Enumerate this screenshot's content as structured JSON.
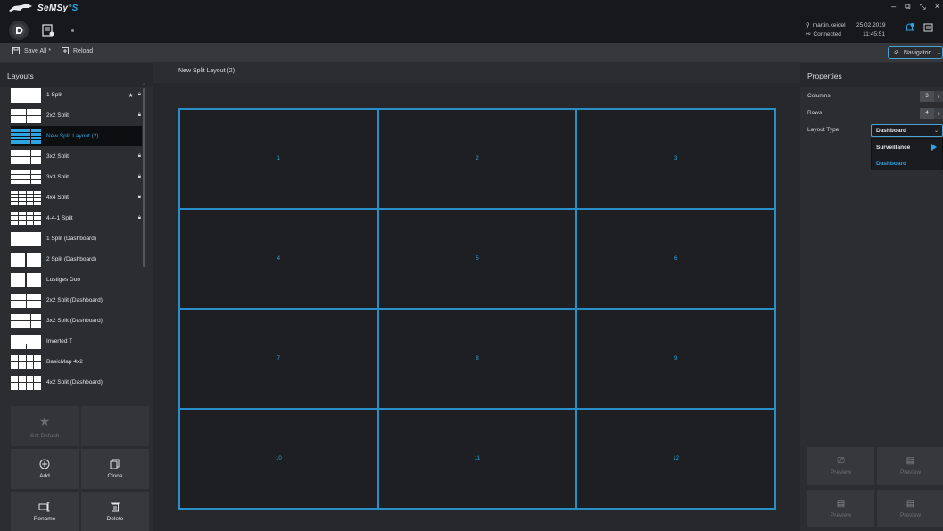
{
  "app": {
    "brand_text": "SeMSy",
    "brand_suffix": "°S"
  },
  "header": {
    "user_name": "martin.keidel",
    "connection_status": "Connected",
    "date": "25.02.2019",
    "time": "11:45:51"
  },
  "toolbar": {
    "save_all_label": "Save All *",
    "reload_label": "Reload",
    "navigator_label": "Navigator"
  },
  "layouts_panel": {
    "title": "Layouts",
    "items": [
      {
        "label": "1 Split",
        "thumb": "1x1",
        "star": true,
        "lock": true
      },
      {
        "label": "2x2 Split",
        "thumb": "2x2",
        "star": false,
        "lock": true
      },
      {
        "label": "New Split Layout (2)",
        "thumb": "3x4",
        "star": false,
        "lock": false,
        "selected": true
      },
      {
        "label": "3x2 Split",
        "thumb": "3x2",
        "star": false,
        "lock": true
      },
      {
        "label": "3x3 Split",
        "thumb": "3x3",
        "star": false,
        "lock": true
      },
      {
        "label": "4x4 Split",
        "thumb": "4x4",
        "star": false,
        "lock": true
      },
      {
        "label": "4-4-1 Split",
        "thumb": "441",
        "star": false,
        "lock": true
      },
      {
        "label": "1 Split (Dashboard)",
        "thumb": "1x1",
        "star": false,
        "lock": false
      },
      {
        "label": "2 Split (Dashboard)",
        "thumb": "2x1",
        "star": false,
        "lock": false
      },
      {
        "label": "Lustiges Duo",
        "thumb": "2x1",
        "star": false,
        "lock": false
      },
      {
        "label": "2x2 Split (Dashboard)",
        "thumb": "2x2",
        "star": false,
        "lock": false
      },
      {
        "label": "3x2 Split (Dashboard)",
        "thumb": "3x2",
        "star": false,
        "lock": false
      },
      {
        "label": "Inverted T",
        "thumb": "invt",
        "star": false,
        "lock": false
      },
      {
        "label": "BasicMap 4x2",
        "thumb": "4x2",
        "star": false,
        "lock": false
      },
      {
        "label": "4x2 Split (Dashboard)",
        "thumb": "4x2",
        "star": false,
        "lock": false
      }
    ],
    "actions": {
      "set_default_label": "Set Default",
      "add_label": "Add",
      "clone_label": "Clone",
      "rename_label": "Rename",
      "delete_label": "Delete"
    }
  },
  "editor": {
    "title": "New Split Layout (2)",
    "cells": [
      "1",
      "2",
      "3",
      "4",
      "5",
      "6",
      "7",
      "8",
      "9",
      "10",
      "11",
      "12"
    ]
  },
  "properties": {
    "title": "Properties",
    "columns_label": "Columns",
    "columns_value": "3",
    "rows_label": "Rows",
    "rows_value": "4",
    "layout_type_label": "Layout Type",
    "layout_type_value": "Dashboard",
    "layout_type_options": [
      "Surveillance",
      "Dashboard"
    ],
    "preview_label": "Preview"
  },
  "colors": {
    "accent": "#2da5e2",
    "background": "#2b2d31",
    "titlebar": "#17181b"
  }
}
